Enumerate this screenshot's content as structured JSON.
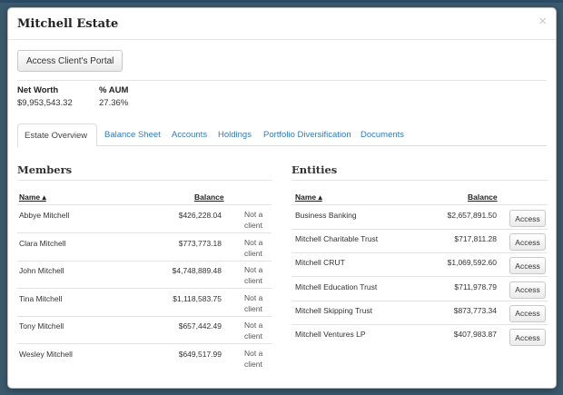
{
  "modal": {
    "title": "Mitchell Estate",
    "close_glyph": "×",
    "portal_button": "Access Client's Portal"
  },
  "stats": {
    "net_worth_label": "Net Worth",
    "net_worth_value": "$9,953,543.32",
    "aum_label": "% AUM",
    "aum_value": "27.36%"
  },
  "tabs": [
    "Estate Overview",
    "Balance Sheet",
    "Accounts",
    "Holdings",
    "Portfolio Diversification",
    "Documents"
  ],
  "active_tab": "Estate Overview",
  "members": {
    "title": "Members",
    "columns": [
      "Name ▴",
      "Balance"
    ],
    "rows": [
      {
        "name": "Abbye Mitchell",
        "balance": "$426,228.04",
        "note_1": "Not a",
        "note_2": "client"
      },
      {
        "name": "Clara Mitchell",
        "balance": "$773,773.18",
        "note_1": "Not a",
        "note_2": "client"
      },
      {
        "name": "John Mitchell",
        "balance": "$4,748,889.48",
        "note_1": "Not a",
        "note_2": "client"
      },
      {
        "name": "Tina Mitchell",
        "balance": "$1,118,583.75",
        "note_1": "Not a",
        "note_2": "client"
      },
      {
        "name": "Tony Mitchell",
        "balance": "$657,442.49",
        "note_1": "Not a",
        "note_2": "client"
      },
      {
        "name": "Wesley Mitchell",
        "balance": "$649,517.99",
        "note_1": "Not a",
        "note_2": "client"
      }
    ]
  },
  "entities": {
    "title": "Entities",
    "columns": [
      "Name ▴",
      "Balance"
    ],
    "access_label": "Access",
    "rows": [
      {
        "name": "Business Banking",
        "balance": "$2,657,891.50"
      },
      {
        "name": "Mitchell Charitable Trust",
        "balance": "$717,811.28"
      },
      {
        "name": "Mitchell CRUT",
        "balance": "$1,069,592.60"
      },
      {
        "name": "Mitchell Education Trust",
        "balance": "$711,978.79"
      },
      {
        "name": "Mitchell Skipping Trust",
        "balance": "$873,773.34"
      },
      {
        "name": "Mitchell Ventures LP",
        "balance": "$407,983.87"
      }
    ]
  },
  "colors": {
    "link": "#337ab7",
    "backdrop": "#3b5a6e"
  }
}
